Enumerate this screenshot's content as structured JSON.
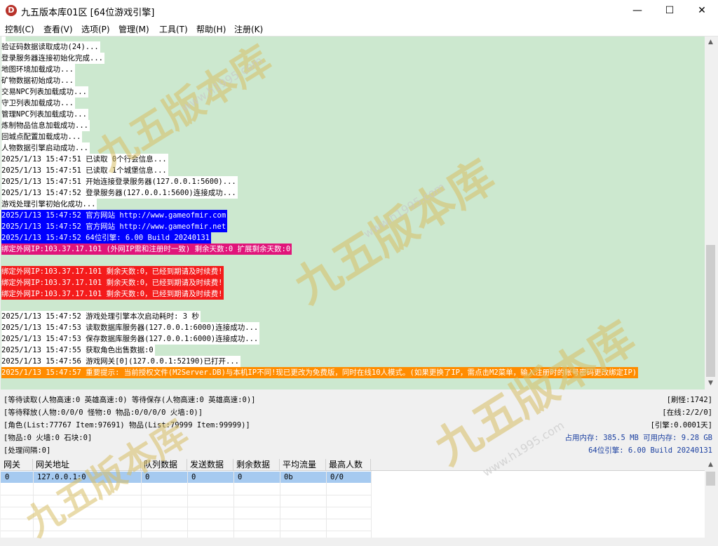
{
  "window": {
    "title": "九五版本库01区 [64位游戏引擎]",
    "icon_letter": "D",
    "minimize": "—",
    "maximize": "☐",
    "close": "✕"
  },
  "menu": [
    "控制(C)",
    "查看(V)",
    "选项(P)",
    "管理(M)",
    "工具(T)",
    "帮助(H)",
    "注册(K)"
  ],
  "log": {
    "background": "#cce8cf",
    "lines": [
      {
        "text": "验证码数据读取成功(24)...",
        "bg": "#ffffff",
        "fg": "#000000"
      },
      {
        "text": "登录服务器连接初始化完成...",
        "bg": "#ffffff",
        "fg": "#000000"
      },
      {
        "text": "地图环境加载成功...",
        "bg": "#ffffff",
        "fg": "#000000"
      },
      {
        "text": "矿物数据初始成功...",
        "bg": "#ffffff",
        "fg": "#000000"
      },
      {
        "text": "交易NPC列表加载成功...",
        "bg": "#ffffff",
        "fg": "#000000"
      },
      {
        "text": "守卫列表加载成功...",
        "bg": "#ffffff",
        "fg": "#000000"
      },
      {
        "text": "管理NPC列表加载成功...",
        "bg": "#ffffff",
        "fg": "#000000"
      },
      {
        "text": "炼制物品信息加载成功...",
        "bg": "#ffffff",
        "fg": "#000000"
      },
      {
        "text": "回城点配置加载成功...",
        "bg": "#ffffff",
        "fg": "#000000"
      },
      {
        "text": "人物数据引擎启动成功...",
        "bg": "#ffffff",
        "fg": "#000000"
      },
      {
        "text": "2025/1/13 15:47:51 已读取 0个行会信息...",
        "bg": "#ffffff",
        "fg": "#000000"
      },
      {
        "text": "2025/1/13 15:47:51 已读取 1个城堡信息...",
        "bg": "#ffffff",
        "fg": "#000000"
      },
      {
        "text": "2025/1/13 15:47:51 开始连接登录服务器(127.0.0.1:5600)...",
        "bg": "#ffffff",
        "fg": "#000000"
      },
      {
        "text": "2025/1/13 15:47:52 登录服务器(127.0.0.1:5600)连接成功...",
        "bg": "#ffffff",
        "fg": "#000000"
      },
      {
        "text": "游戏处理引擎初始化成功...",
        "bg": "#ffffff",
        "fg": "#000000"
      },
      {
        "text": "2025/1/13 15:47:52 官方网站 http://www.gameofmir.com",
        "bg": "#0000ff",
        "fg": "#ffffff"
      },
      {
        "text": "2025/1/13 15:47:52 官方网站 http://www.gameofmir.net",
        "bg": "#0000ff",
        "fg": "#ffffff"
      },
      {
        "text": "2025/1/13 15:47:52 64位引擎: 6.00 Build 20240131",
        "bg": "#0000ff",
        "fg": "#ffffff"
      },
      {
        "text": "绑定外网IP:103.37.17.101 (外网IP需和注册时一致) 剩余天数:0 扩展剩余天数:0",
        "bg": "#e0157a",
        "fg": "#ffffff"
      },
      {
        "text": "",
        "bg": "",
        "fg": "#000000"
      },
      {
        "text": "绑定外网IP:103.37.17.101 剩余天数:0，已经到期请及时续费!",
        "bg": "#f41b1b",
        "fg": "#ffffff"
      },
      {
        "text": "绑定外网IP:103.37.17.101 剩余天数:0，已经到期请及时续费!",
        "bg": "#f41b1b",
        "fg": "#ffffff"
      },
      {
        "text": "绑定外网IP:103.37.17.101 剩余天数:0，已经到期请及时续费!",
        "bg": "#f41b1b",
        "fg": "#ffffff"
      },
      {
        "text": "",
        "bg": "",
        "fg": "#000000"
      },
      {
        "text": "2025/1/13 15:47:52 游戏处理引擎本次启动耗时: 3 秒",
        "bg": "#ffffff",
        "fg": "#000000"
      },
      {
        "text": "2025/1/13 15:47:53 读取数据库服务器(127.0.0.1:6000)连接成功...",
        "bg": "#ffffff",
        "fg": "#000000"
      },
      {
        "text": "2025/1/13 15:47:53 保存数据库服务器(127.0.0.1:6000)连接成功...",
        "bg": "#ffffff",
        "fg": "#000000"
      },
      {
        "text": "2025/1/13 15:47:55 获取角色出售数据:0",
        "bg": "#ffffff",
        "fg": "#000000"
      },
      {
        "text": "2025/1/13 15:47:56 游戏网关[0](127.0.0.1:52190)已打开...",
        "bg": "#ffffff",
        "fg": "#000000"
      },
      {
        "text": "2025/1/13 15:47:57 重要提示: 当前授权文件(M2Server.DB)与本机IP不同!现已更改为免费版，同时在线10人模式。(如果更换了IP，需点击M2菜单，输入注册时的账号密码更改绑定IP)",
        "bg": "#ff8c00",
        "fg": "#ffffff"
      }
    ]
  },
  "status": {
    "line1": "[等待读取(人物高速:0 英雄高速:0) 等待保存(人物高速:0 英雄高速:0)]",
    "line2": "[等待释放(人物:0/0/0 怪物:0 物品:0/0/0/0 火墙:0)]",
    "line3": "[角色(List:77767 Item:97691) 物品(List:79999 Item:99999)]",
    "line4": "[物品:0 火墙:0 石块:0]",
    "line5": "[处理间隔:0]",
    "refresh": "[刷怪:1742]",
    "online": "[在线:2/2/0]",
    "engine": "[引擎:0.0001天]",
    "memory": "占用内存: 385.5 MB 可用内存: 9.28 GB",
    "version": "64位引擎: 6.00 Build 20240131"
  },
  "gateway_table": {
    "headers": [
      "网关",
      "网关地址",
      "队列数据",
      "发送数据",
      "剩余数据",
      "平均流量",
      "最高人数"
    ],
    "rows": [
      [
        "0",
        "127.0.0.1:0",
        "0",
        "0",
        "0",
        "0b",
        "0/0"
      ]
    ]
  },
  "watermark": {
    "text": "九五版本库",
    "url": "www.h1995.com"
  }
}
